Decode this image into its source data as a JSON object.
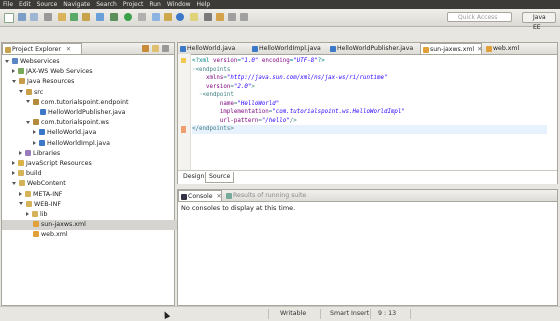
{
  "menu": [
    "File",
    "Edit",
    "Source",
    "Navigate",
    "Search",
    "Project",
    "Run",
    "Window",
    "Help"
  ],
  "toolbar": {
    "quick_access_placeholder": "Quick Access",
    "perspective_label": "Java EE"
  },
  "explorer": {
    "title": "Project Explorer",
    "tree": [
      {
        "label": "Webservices",
        "level": 0,
        "state": "open",
        "icon": "project-icon"
      },
      {
        "label": "JAX-WS Web Services",
        "level": 1,
        "state": "closed",
        "icon": "webservices-icon"
      },
      {
        "label": "Java Resources",
        "level": 1,
        "state": "open",
        "icon": "java-resources-icon"
      },
      {
        "label": "src",
        "level": 2,
        "state": "open",
        "icon": "source-folder-icon"
      },
      {
        "label": "com.tutorialspoint.endpoint",
        "level": 3,
        "state": "open",
        "icon": "package-icon"
      },
      {
        "label": "HelloWorldPublisher.java",
        "level": 4,
        "state": "leaf",
        "icon": "java-file-icon"
      },
      {
        "label": "com.tutorialspoint.ws",
        "level": 3,
        "state": "open",
        "icon": "package-icon"
      },
      {
        "label": "HelloWorld.java",
        "level": 4,
        "state": "closed",
        "icon": "java-file-icon"
      },
      {
        "label": "HelloWorldImpl.java",
        "level": 4,
        "state": "closed",
        "icon": "java-file-icon"
      },
      {
        "label": "Libraries",
        "level": 2,
        "state": "closed",
        "icon": "library-icon"
      },
      {
        "label": "JavaScript Resources",
        "level": 1,
        "state": "closed",
        "icon": "javascript-icon"
      },
      {
        "label": "build",
        "level": 1,
        "state": "closed",
        "icon": "folder-icon"
      },
      {
        "label": "WebContent",
        "level": 1,
        "state": "open",
        "icon": "folder-icon"
      },
      {
        "label": "META-INF",
        "level": 2,
        "state": "closed",
        "icon": "folder-icon"
      },
      {
        "label": "WEB-INF",
        "level": 2,
        "state": "open",
        "icon": "folder-icon"
      },
      {
        "label": "lib",
        "level": 3,
        "state": "closed",
        "icon": "folder-icon"
      },
      {
        "label": "sun-jaxws.xml",
        "level": 3,
        "state": "leaf",
        "icon": "xml-file-icon",
        "selected": true
      },
      {
        "label": "web.xml",
        "level": 3,
        "state": "leaf",
        "icon": "xml-file-icon"
      }
    ]
  },
  "editor": {
    "tabs": [
      {
        "label": "HelloWorld.java",
        "active": false
      },
      {
        "label": "HelloWorldImpl.java",
        "active": false
      },
      {
        "label": "HelloWorldPublisher.java",
        "active": false
      },
      {
        "label": "sun-jaxws.xml",
        "active": true
      },
      {
        "label": "web.xml",
        "active": false
      }
    ],
    "code": [
      {
        "parts": [
          [
            "pi",
            "<?xml "
          ],
          [
            "attr",
            "version"
          ],
          [
            "pi",
            "="
          ],
          [
            "val",
            "\"1.0\""
          ],
          [
            "pi",
            " "
          ],
          [
            "attr",
            "encoding"
          ],
          [
            "pi",
            "="
          ],
          [
            "val",
            "\"UTF-8\""
          ],
          [
            "pi",
            "?>"
          ]
        ]
      },
      {
        "parts": [
          [
            "tag",
            "◦<endpoints"
          ]
        ]
      },
      {
        "parts": [
          [
            "attr",
            "    xmlns"
          ],
          [
            "tag",
            "="
          ],
          [
            "val",
            "\"http://java.sun.com/xml/ns/jax-ws/ri/runtime\""
          ]
        ]
      },
      {
        "parts": [
          [
            "attr",
            "    version"
          ],
          [
            "tag",
            "="
          ],
          [
            "val",
            "\"2.0\""
          ],
          [
            "tag",
            ">"
          ]
        ]
      },
      {
        "parts": [
          [
            "tag",
            "  ◦<endpoint"
          ]
        ]
      },
      {
        "parts": [
          [
            "attr",
            "        name"
          ],
          [
            "tag",
            "="
          ],
          [
            "val",
            "\"HelloWorld\""
          ]
        ]
      },
      {
        "parts": [
          [
            "attr",
            "        implementation"
          ],
          [
            "tag",
            "="
          ],
          [
            "val",
            "\"com.tutorialspoint.ws.HelloWorldImpl\""
          ]
        ]
      },
      {
        "parts": [
          [
            "attr",
            "        url-pattern"
          ],
          [
            "tag",
            "="
          ],
          [
            "val",
            "\"/hello\""
          ],
          [
            "tag",
            "/>"
          ]
        ]
      },
      {
        "parts": [
          [
            "tag",
            "</endpoints>"
          ]
        ]
      }
    ],
    "bottom_tabs": [
      "Design",
      "Source"
    ]
  },
  "console": {
    "tabs": [
      "Console",
      "Results of running suite"
    ],
    "message": "No consoles to display at this time."
  },
  "statusbar": {
    "mode": "Writable",
    "insert": "Smart Insert",
    "position": "9 : 13"
  },
  "colors": {
    "menubar_bg": "#3c3b37",
    "selection": "#d6d4d0",
    "xml_tag": "#3f7f7f",
    "xml_attr": "#7f007f",
    "xml_value": "#2a00ff"
  }
}
